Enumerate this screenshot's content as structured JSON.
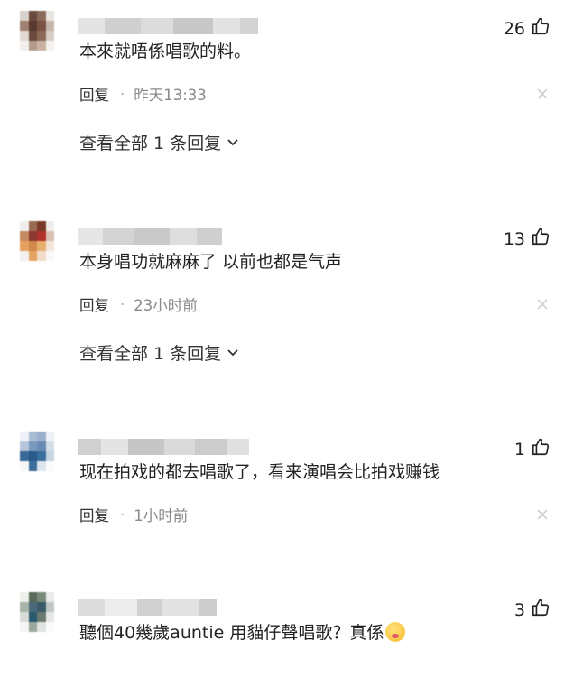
{
  "comments": [
    {
      "likes": "26",
      "text": "本來就唔係唱歌的料。",
      "reply_label": "回复",
      "separator": "·",
      "time": "昨天13:33",
      "more_label": "查看全部 1 条回复"
    },
    {
      "likes": "13",
      "text": "本身唱功就麻麻了 以前也都是气声",
      "reply_label": "回复",
      "separator": "·",
      "time": "23小时前",
      "more_label": "查看全部 1 条回复"
    },
    {
      "likes": "1",
      "text": "现在拍戏的都去唱歌了，看来演唱会比拍戏赚钱",
      "reply_label": "回复",
      "separator": "·",
      "time": "1小时前"
    },
    {
      "likes": "3",
      "text": "聽個40幾歲auntie 用貓仔聲唱歌？真係"
    }
  ],
  "icons": {
    "like": "thumbs-up-icon",
    "close": "close-icon",
    "expand": "chevron-down-icon",
    "emoji": "kissing-face-emoji"
  }
}
